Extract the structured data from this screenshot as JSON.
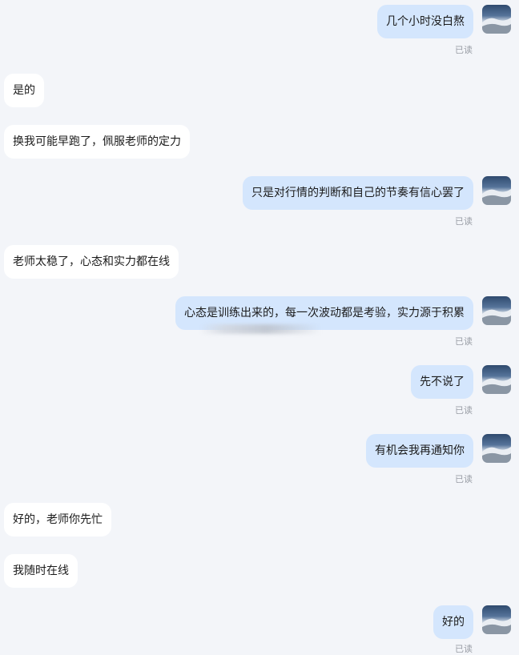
{
  "messages": [
    {
      "side": "out",
      "text": "几个小时没白熬",
      "status": "已读"
    },
    {
      "side": "in",
      "text": "是的"
    },
    {
      "side": "in",
      "text": "换我可能早跑了，佩服老师的定力"
    },
    {
      "side": "out",
      "text": "只是对行情的判断和自己的节奏有信心罢了",
      "status": "已读"
    },
    {
      "side": "in",
      "text": "老师太稳了，心态和实力都在线"
    },
    {
      "side": "out",
      "text": "心态是训练出来的，每一次波动都是考验，实力源于积累",
      "status": "已读"
    },
    {
      "side": "out",
      "text": "先不说了",
      "status": "已读"
    },
    {
      "side": "out",
      "text": "有机会我再通知你",
      "status": "已读"
    },
    {
      "side": "in",
      "text": "好的，老师你先忙"
    },
    {
      "side": "in",
      "text": "我随时在线"
    },
    {
      "side": "out",
      "text": "好的",
      "status": "已读"
    }
  ],
  "icons": {
    "avatar": "sky-landscape-avatar"
  },
  "colors": {
    "background": "#f3f5f9",
    "outgoing_bubble": "#d4e6fd",
    "incoming_bubble": "#ffffff",
    "read_status": "#9a9ea6"
  }
}
